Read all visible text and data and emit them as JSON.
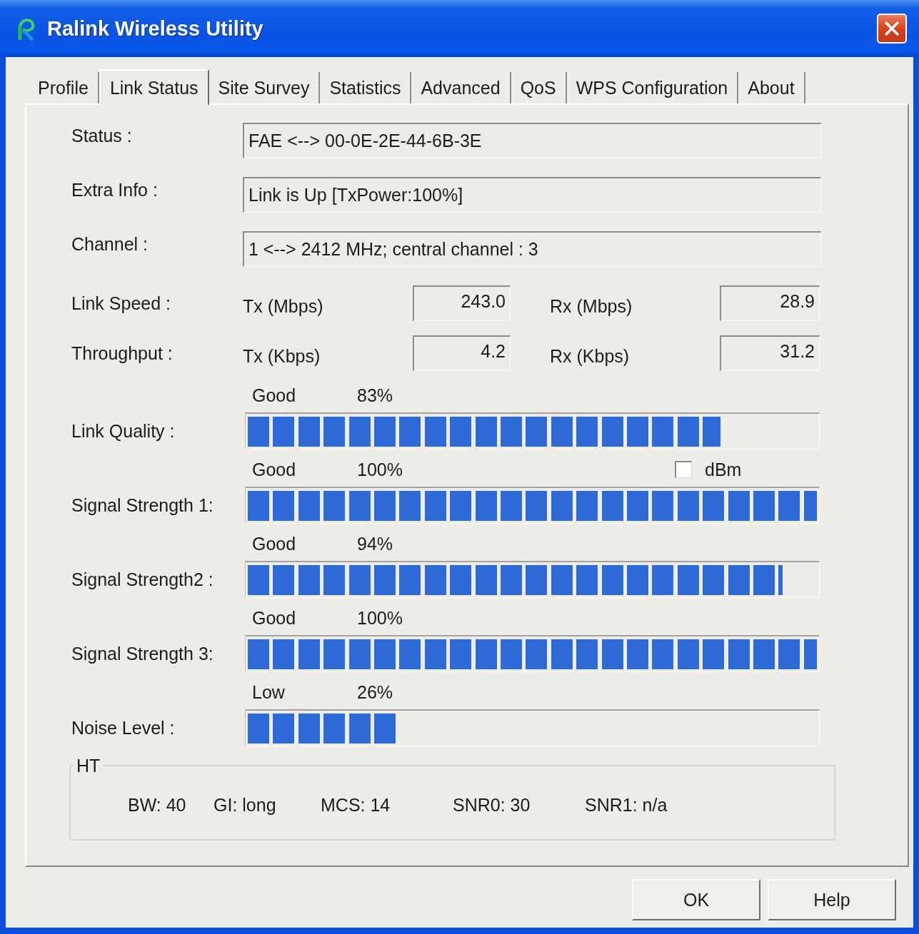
{
  "window": {
    "title": "Ralink Wireless Utility"
  },
  "tabs": [
    {
      "label": "Profile",
      "selected": false
    },
    {
      "label": "Link Status",
      "selected": true
    },
    {
      "label": "Site Survey",
      "selected": false
    },
    {
      "label": "Statistics",
      "selected": false
    },
    {
      "label": "Advanced",
      "selected": false
    },
    {
      "label": "QoS",
      "selected": false
    },
    {
      "label": "WPS Configuration",
      "selected": false
    },
    {
      "label": "About",
      "selected": false
    }
  ],
  "info_fields": [
    {
      "label": "Status :",
      "value": "FAE <--> 00-0E-2E-44-6B-3E"
    },
    {
      "label": "Extra Info :",
      "value": "Link is Up [TxPower:100%]"
    },
    {
      "label": "Channel :",
      "value": "1 <--> 2412 MHz; central channel : 3"
    }
  ],
  "rates": [
    {
      "label": "Link Speed :",
      "tx_label": "Tx (Mbps)",
      "tx_value": "243.0",
      "rx_label": "Rx (Mbps)",
      "rx_value": "28.9"
    },
    {
      "label": "Throughput :",
      "tx_label": "Tx (Kbps)",
      "tx_value": "4.2",
      "rx_label": "Rx (Kbps)",
      "rx_value": "31.2"
    }
  ],
  "meters": [
    {
      "label": "Link Quality :",
      "rating": "Good",
      "percent": "83%",
      "level": 0.83
    },
    {
      "label": "Signal Strength 1:",
      "rating": "Good",
      "percent": "100%",
      "level": 1.0,
      "option": {
        "label": "dBm",
        "checked": false
      }
    },
    {
      "label": "Signal Strength2 :",
      "rating": "Good",
      "percent": "94%",
      "level": 0.94
    },
    {
      "label": "Signal Strength 3:",
      "rating": "Good",
      "percent": "100%",
      "level": 1.0
    },
    {
      "label": "Noise Level :",
      "rating": "Low",
      "percent": "26%",
      "level": 0.26
    }
  ],
  "ht": {
    "title": "HT",
    "items": [
      "BW: 40",
      "GI: long",
      "MCS: 14",
      "SNR0: 30",
      "SNR1: n/a"
    ]
  },
  "buttons": [
    "OK",
    "Help"
  ]
}
